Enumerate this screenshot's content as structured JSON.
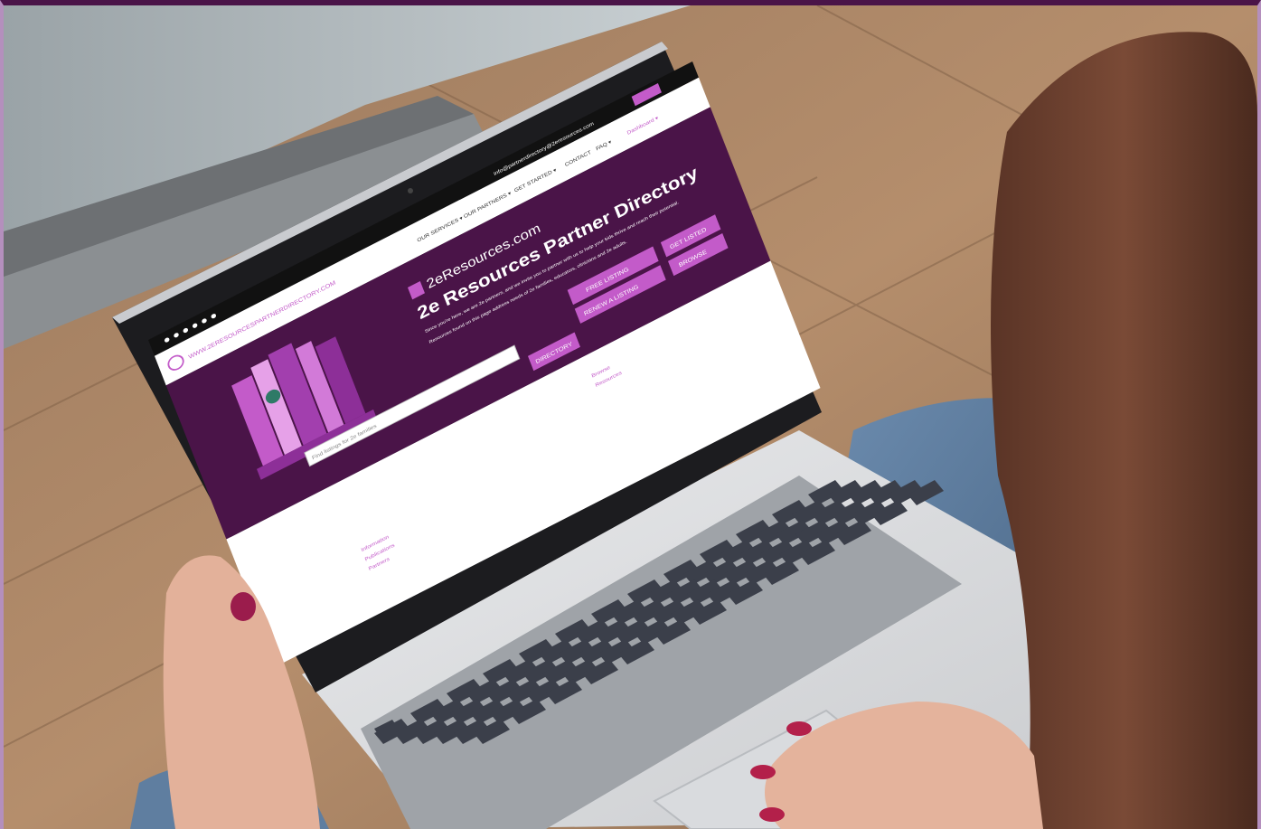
{
  "site": {
    "header_email": "info@partnerdirectory@2eresources.com",
    "nav_items": [
      "OUR SERVICES ▾",
      "OUR PARTNERS ▾",
      "GET STARTED ▾",
      "CONTACT",
      "FAQ ▾",
      "Dashboard ▾"
    ],
    "logo_text": "WWW.2ERESOURCESPARTNERDIRECTORY.COM",
    "social_icons": [
      "facebook-icon",
      "twitter-icon",
      "youtube-icon",
      "instagram-icon",
      "linkedin-icon",
      "email-icon"
    ],
    "brand_mark": "2eResources.com",
    "hero_title": "2e Resources Partner Directory",
    "hero_paragraph_1": "Since you're here, we are 2e partners, and we invite you to partner with us to help your kids thrive and reach their potential.",
    "hero_paragraph_2": "Resources found on this page address needs of 2e families, educators, clinicians and 2e adults.",
    "buttons": [
      "FREE LISTING",
      "GET LISTED",
      "RENEW A LISTING",
      "DIRECTORY",
      "BROWSE"
    ],
    "search_placeholder": "Find listings for 2e families",
    "links_right": [
      "Browse",
      "Resources"
    ],
    "links_bottom": [
      "Information",
      "Publications",
      "Partners"
    ]
  },
  "colors": {
    "brand_purple": "#4a1448",
    "accent_pink": "#c35bc9",
    "frame_lilac": "#b48fbd"
  }
}
